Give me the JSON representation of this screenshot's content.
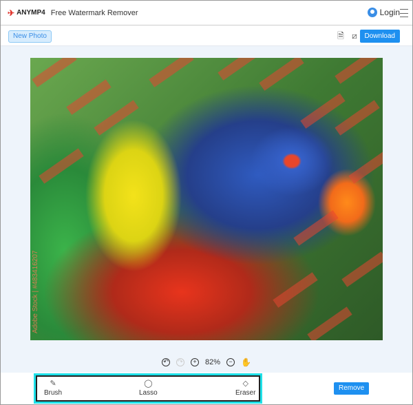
{
  "header": {
    "brand": "ANYMP4",
    "title": "Free Watermark Remover",
    "login": "Login"
  },
  "toolbar": {
    "new_photo": "New Photo",
    "download": "Download",
    "icons": [
      "history-icon",
      "crop-icon"
    ]
  },
  "image": {
    "watermark_text": "Adobe Stock | #483416207"
  },
  "zoom": {
    "level": "82%"
  },
  "tools": [
    {
      "label": "Brush",
      "icon": "brush-icon"
    },
    {
      "label": "Lasso",
      "icon": "lasso-icon"
    },
    {
      "label": "Eraser",
      "icon": "eraser-icon"
    }
  ],
  "actions": {
    "remove": "Remove"
  },
  "colors": {
    "accent": "#1e90f0",
    "highlight": "#1ee0e8"
  }
}
